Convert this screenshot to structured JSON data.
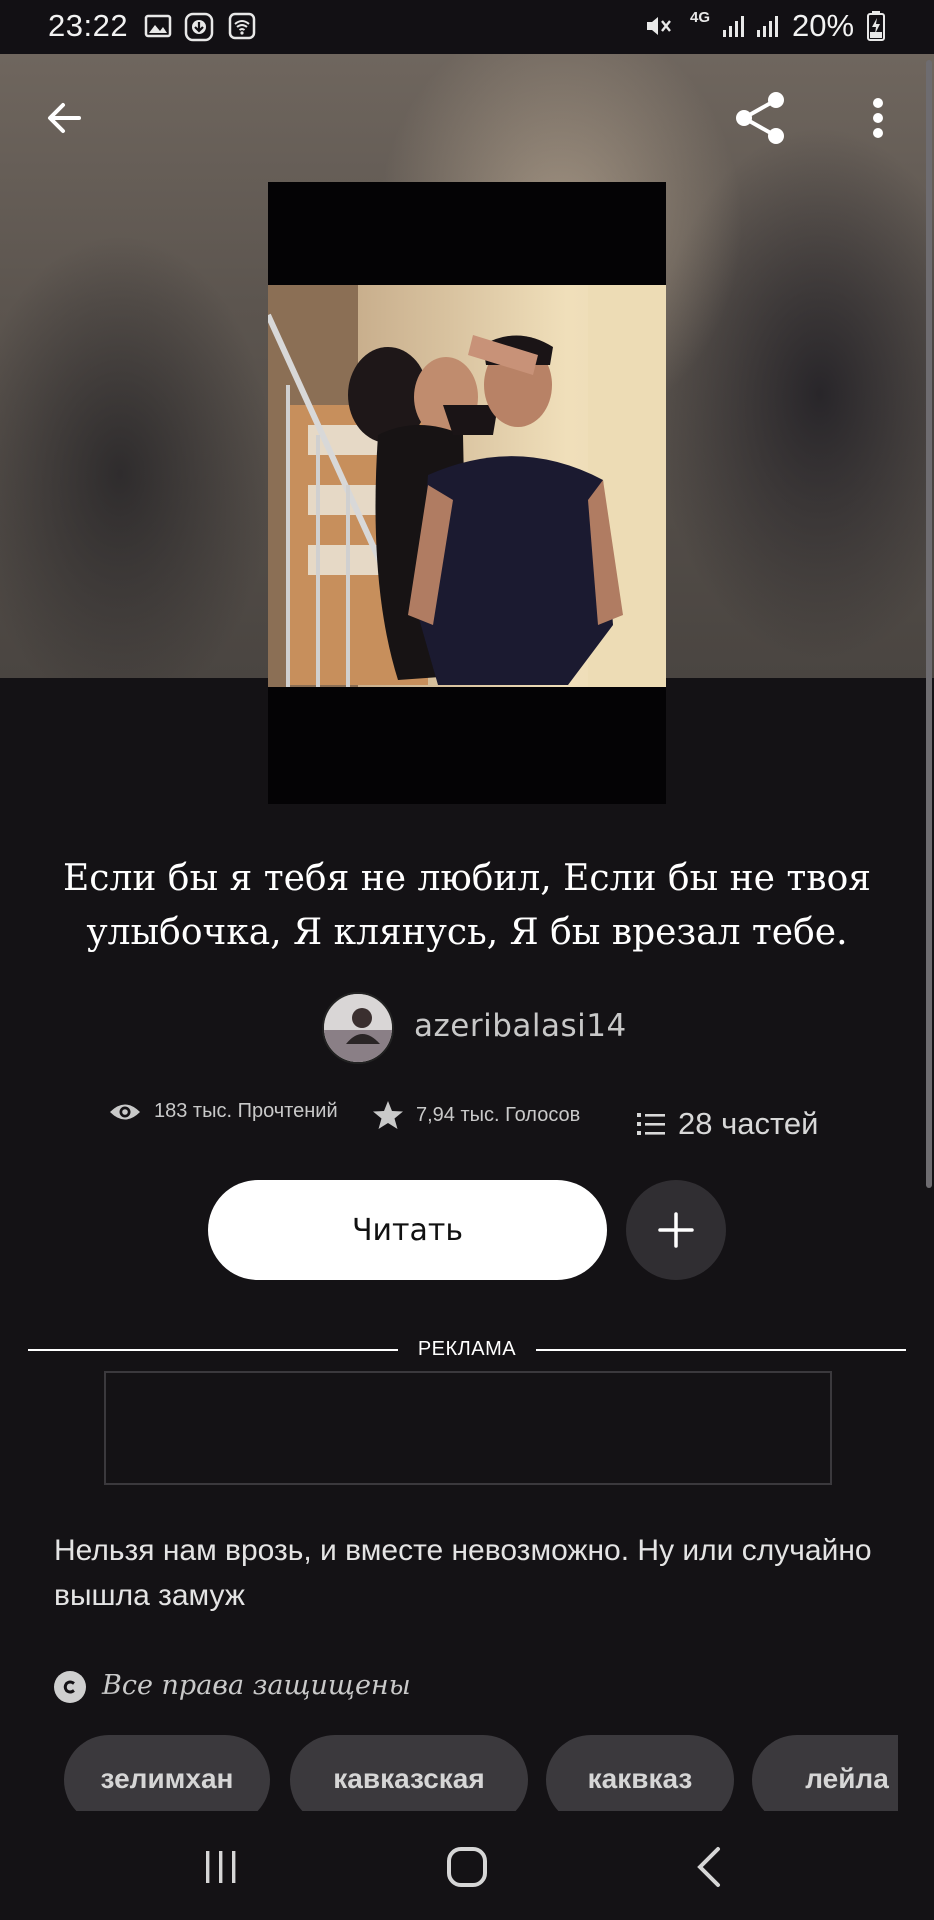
{
  "status_bar": {
    "time": "23:22",
    "network": "4G",
    "battery": "20%"
  },
  "toolbar": {
    "back_icon": "arrow-left-icon",
    "share_icon": "share-icon",
    "menu_icon": "more-vertical-icon"
  },
  "story": {
    "title": "Если бы я тебя не любил, Если бы не твоя улыбочка, Я клянусь, Я бы врезал тебе.",
    "author": "azeribalasi14",
    "stats": {
      "reads": "183 тыс. Прочтений",
      "votes": "7,94 тыс. Голосов",
      "parts": "28 частей"
    },
    "read_label": "Читать",
    "description": "Нельзя нам врозь, и вместе невозможно. Ну или случайно вышла замуж",
    "copyright": "Все права защищены",
    "tags": [
      "зелимхан",
      "кавказская",
      "каквказ",
      "лейла"
    ]
  },
  "ad": {
    "label": "РЕКЛАМА"
  },
  "colors": {
    "background": "#141215",
    "button_primary": "#ffffff",
    "button_secondary": "#302e32",
    "tag_bg": "#3b393d"
  }
}
